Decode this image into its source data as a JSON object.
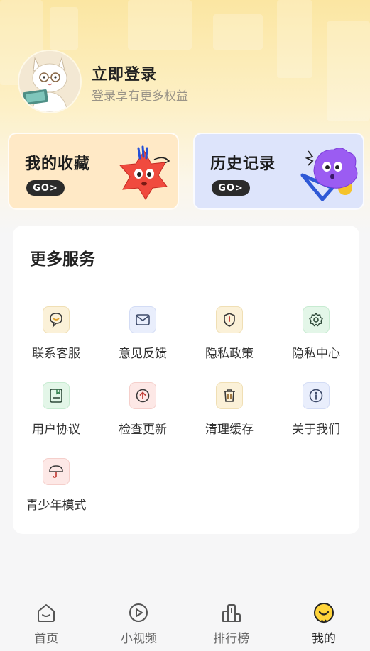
{
  "profile": {
    "login_title": "立即登录",
    "login_subtitle": "登录享有更多权益"
  },
  "quick_cards": {
    "favorites": {
      "title": "我的收藏",
      "go": "GO>"
    },
    "history": {
      "title": "历史记录",
      "go": "GO>"
    }
  },
  "services": {
    "title": "更多服务",
    "items": [
      {
        "label": "联系客服",
        "icon": "customer-service-icon",
        "color": "#d29b2a"
      },
      {
        "label": "意见反馈",
        "icon": "feedback-mail-icon",
        "color": "#3d4a6a"
      },
      {
        "label": "隐私政策",
        "icon": "privacy-shield-icon",
        "color": "#8a5a1c"
      },
      {
        "label": "隐私中心",
        "icon": "settings-gear-icon",
        "color": "#2f7d4b"
      },
      {
        "label": "用户协议",
        "icon": "user-agreement-icon",
        "color": "#2f7d4b"
      },
      {
        "label": "检查更新",
        "icon": "update-arrow-icon",
        "color": "#c2413a"
      },
      {
        "label": "清理缓存",
        "icon": "trash-icon",
        "color": "#8a5a1c"
      },
      {
        "label": "关于我们",
        "icon": "info-icon",
        "color": "#3d4a6a"
      },
      {
        "label": "青少年模式",
        "icon": "umbrella-icon",
        "color": "#c2413a"
      }
    ]
  },
  "bottom_nav": {
    "items": [
      {
        "label": "首页",
        "icon": "home-icon"
      },
      {
        "label": "小视频",
        "icon": "video-play-icon"
      },
      {
        "label": "排行榜",
        "icon": "ranking-icon"
      },
      {
        "label": "我的",
        "icon": "smiley-icon",
        "active": true
      }
    ]
  }
}
